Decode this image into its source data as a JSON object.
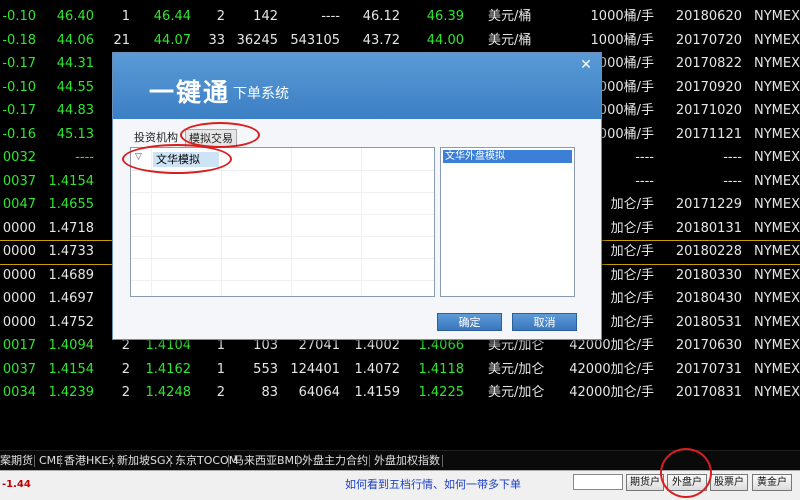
{
  "quote_rows": [
    {
      "cells": [
        "-0.10",
        "46.40",
        "1",
        "46.44",
        "2",
        "142",
        "----",
        "46.12",
        "46.39",
        "美元/桶",
        "1000桶/手",
        "20180620",
        "NYMEX"
      ]
    },
    {
      "cells": [
        "-0.18",
        "44.06",
        "21",
        "44.07",
        "33",
        "36245",
        "543105",
        "43.72",
        "44.00",
        "美元/桶",
        "1000桶/手",
        "20170720",
        "NYMEX"
      ]
    },
    {
      "cells": [
        "-0.17",
        "44.31",
        "",
        "",
        "",
        "",
        "",
        "",
        "",
        "",
        "1000桶/手",
        "20170822",
        "NYMEX"
      ]
    },
    {
      "cells": [
        "-0.10",
        "44.55",
        "",
        "",
        "",
        "",
        "",
        "",
        "",
        "",
        "1000桶/手",
        "20170920",
        "NYMEX"
      ]
    },
    {
      "cells": [
        "-0.17",
        "44.83",
        "",
        "",
        "",
        "",
        "",
        "",
        "",
        "",
        "1000桶/手",
        "20171020",
        "NYMEX"
      ]
    },
    {
      "cells": [
        "-0.16",
        "45.13",
        "",
        "",
        "",
        "",
        "",
        "",
        "",
        "",
        "1000桶/手",
        "20171121",
        "NYMEX"
      ]
    },
    {
      "cells": [
        "0032",
        "----",
        "",
        "",
        "",
        "",
        "",
        "",
        "",
        "",
        "----",
        "----",
        "NYMEX"
      ]
    },
    {
      "cells": [
        "0037",
        "1.4154",
        "",
        "",
        "",
        "",
        "",
        "",
        "",
        "",
        "----",
        "----",
        "NYMEX"
      ]
    },
    {
      "cells": [
        "0047",
        "1.4655",
        "",
        "",
        "",
        "",
        "",
        "",
        "",
        "",
        "加仑/手",
        "20171229",
        "NYMEX"
      ]
    },
    {
      "cells": [
        "0000",
        "1.4718",
        "",
        "",
        "",
        "",
        "",
        "",
        "",
        "",
        "加仑/手",
        "20180131",
        "NYMEX"
      ]
    },
    {
      "cells": [
        "0000",
        "1.4733",
        "",
        "",
        "",
        "",
        "",
        "",
        "",
        "",
        "加仑/手",
        "20180228",
        "NYMEX"
      ]
    },
    {
      "cells": [
        "0000",
        "1.4689",
        "",
        "",
        "",
        "",
        "",
        "",
        "",
        "",
        "加仑/手",
        "20180330",
        "NYMEX"
      ]
    },
    {
      "cells": [
        "0000",
        "1.4697",
        "",
        "",
        "",
        "",
        "",
        "",
        "",
        "",
        "加仑/手",
        "20180430",
        "NYMEX"
      ]
    },
    {
      "cells": [
        "0000",
        "1.4752",
        "",
        "",
        "",
        "",
        "",
        "",
        "",
        "",
        "加仑/手",
        "20180531",
        "NYMEX"
      ]
    },
    {
      "cells": [
        "0017",
        "1.4094",
        "2",
        "1.4104",
        "1",
        "103",
        "27041",
        "1.4002",
        "1.4066",
        "美元/加仑",
        "42000加仑/手",
        "20170630",
        "NYMEX"
      ]
    },
    {
      "cells": [
        "0037",
        "1.4154",
        "2",
        "1.4162",
        "1",
        "553",
        "124401",
        "1.4072",
        "1.4118",
        "美元/加仑",
        "42000加仑/手",
        "20170731",
        "NYMEX"
      ]
    },
    {
      "cells": [
        "0034",
        "1.4239",
        "2",
        "1.4248",
        "2",
        "83",
        "64064",
        "1.4159",
        "1.4225",
        "美元/加仑",
        "42000加仑/手",
        "20170831",
        "NYMEX"
      ]
    }
  ],
  "tabs": [
    "案期货",
    "CME",
    "香港HKEx",
    "新加坡SGX",
    "东京TOCOM",
    "马来西亚BMD",
    "外盘主力合约",
    "外盘加权指数"
  ],
  "status": {
    "left_value": "-1.44",
    "hint": "如何看到五档行情、如何一带多下单",
    "buttons": [
      "期货户",
      "外盘户",
      "股票户",
      "黄金户"
    ]
  },
  "dialog": {
    "title_big": "一键通",
    "title_small": "下单系统",
    "close_symbol": "✕",
    "tab_institution": "投资机构",
    "tab_simulated": "模拟交易",
    "tree_item": "文华模拟",
    "account_item": "文华外盘模拟",
    "ok_label": "确定",
    "cancel_label": "取消"
  },
  "colors": {
    "up_green": "#2fe62f",
    "text_white": "#e6e6e6",
    "text_yellow": "#e8e82a",
    "dialog_header": "#3b7fc4",
    "annotation_red": "#d81e1e"
  }
}
